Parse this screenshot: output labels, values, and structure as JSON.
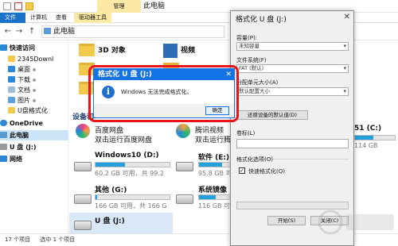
{
  "window": {
    "context_tab": "管理",
    "title": "此电脑",
    "ribbon_tabs": [
      "文件",
      "计算机",
      "查看",
      "驱动器工具"
    ],
    "address": "此电脑",
    "back_icon": "back-arrow-icon",
    "forward_icon": "forward-arrow-icon",
    "up_icon": "up-arrow-icon"
  },
  "sidebar": {
    "items": [
      {
        "label": "快速访问",
        "icon": "star-icon"
      },
      {
        "label": "2345Downl",
        "icon": "folder-icon"
      },
      {
        "label": "桌面",
        "icon": "desktop-icon"
      },
      {
        "label": "下载",
        "icon": "download-icon"
      },
      {
        "label": "文档",
        "icon": "document-icon"
      },
      {
        "label": "图片",
        "icon": "picture-icon"
      },
      {
        "label": "U盘格式化",
        "icon": "folder-icon"
      },
      {
        "label": "OneDrive",
        "icon": "cloud-icon"
      },
      {
        "label": "此电脑",
        "icon": "pc-icon"
      },
      {
        "label": "U 盘 (J:)",
        "icon": "usb-drive-icon"
      },
      {
        "label": "网络",
        "icon": "network-icon"
      }
    ]
  },
  "content": {
    "folders": [
      {
        "name": "3D 对象"
      },
      {
        "name": "视频"
      }
    ],
    "section_label": "设备和",
    "apps": [
      {
        "name": "百度网盘",
        "sub": "双击运行百度网盘"
      },
      {
        "name": "腾讯视频",
        "sub": "双击运行腾讯视频"
      }
    ],
    "drives": [
      {
        "name": "Windows10 (D:)",
        "sub": "60.2 GB 可用，共 99.2",
        "fill": 0.4
      },
      {
        "name": "软件 (E:)",
        "sub": "95.8 GB 可用，共 166",
        "fill": 0.42
      },
      {
        "name": "其他 (G:)",
        "sub": "166 GB 可用，共 166 G",
        "fill": 0.02
      },
      {
        "name": "系统镜像",
        "sub": "116 GB 可用，共 166",
        "fill": 0.3
      },
      {
        "name": "U 盘 (J:)",
        "sub": ""
      }
    ],
    "right_col": [
      {
        "name": "51 (C:)",
        "sub": "114 GB"
      }
    ]
  },
  "status": {
    "items_count": "17 个项目",
    "selected": "选中 1 个项目"
  },
  "format_dialog": {
    "title": "格式化 U 盘 (J:)",
    "capacity_label": "容量(P):",
    "capacity_value": "未知容量",
    "fs_label": "文件系统(F)",
    "fs_value": "FAT (默认)",
    "alloc_label": "分配单元大小(A)",
    "alloc_value": "默认配置大小",
    "restore_button": "还原设备的默认值(D)",
    "volume_label": "卷标(L)",
    "volume_value": "",
    "options_label": "格式化选项(O)",
    "quick_format": "快速格式化(Q)",
    "quick_checked": true,
    "progress": 0,
    "start_button": "开始(S)",
    "close_button": "关闭(C)"
  },
  "message_box": {
    "title": "格式化 U 盘 (J:)",
    "message": "Windows 无法完成格式化。",
    "ok_button": "确定",
    "icon": "info-icon"
  },
  "colors": {
    "accent": "#1473e6",
    "highlight": "#e8141c",
    "capacity_fill": "#26a0da"
  }
}
